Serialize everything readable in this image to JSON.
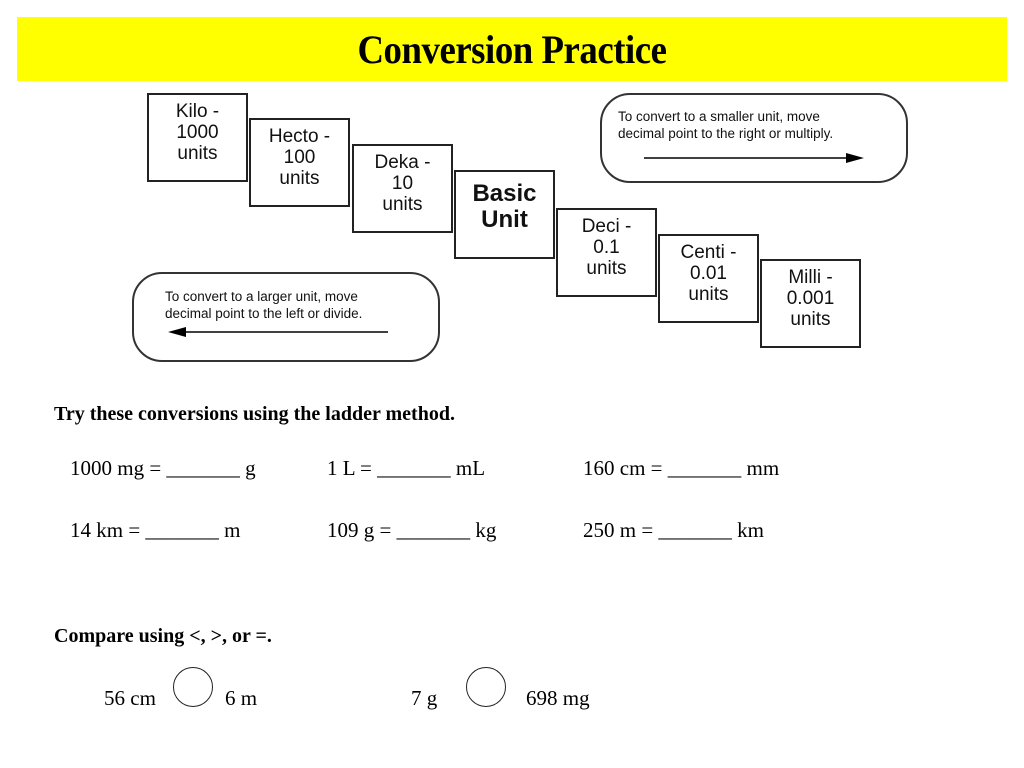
{
  "title": "Conversion Practice",
  "colors": {
    "title_background": "#ffff00",
    "text": "#000000"
  },
  "ladder": {
    "steps": [
      {
        "lines": [
          "Kilo -",
          "1000",
          "units"
        ]
      },
      {
        "lines": [
          "Hecto -",
          "100",
          "units"
        ]
      },
      {
        "lines": [
          "Deka -",
          "10",
          "units"
        ]
      },
      {
        "lines": [
          "Basic",
          "Unit"
        ]
      },
      {
        "lines": [
          "Deci -",
          "0.1",
          "units"
        ]
      },
      {
        "lines": [
          "Centi -",
          "0.01",
          "units"
        ]
      },
      {
        "lines": [
          "Milli -",
          "0.001",
          "units"
        ]
      }
    ],
    "smaller_note": {
      "line1": "To convert to a smaller unit, move",
      "line2": "decimal  point to the right or multiply.",
      "arrow": "right-arrow"
    },
    "larger_note": {
      "line1": "To convert to a larger unit, move",
      "line2": "decimal  point to the left or divide.",
      "arrow": "left-arrow"
    }
  },
  "conversions": {
    "heading": "Try these conversions using the ladder method.",
    "rows": [
      [
        "1000 mg = _______ g",
        "1 L = _______ mL",
        "160 cm = _______ mm"
      ],
      [
        "14 km = _______ m",
        "109 g = _______ kg",
        "250 m = _______ km"
      ]
    ]
  },
  "compare": {
    "heading": "Compare using <, >, or =.",
    "items": [
      {
        "left": "56 cm",
        "right": "6 m"
      },
      {
        "left": "7 g",
        "right": "698 mg"
      }
    ]
  }
}
